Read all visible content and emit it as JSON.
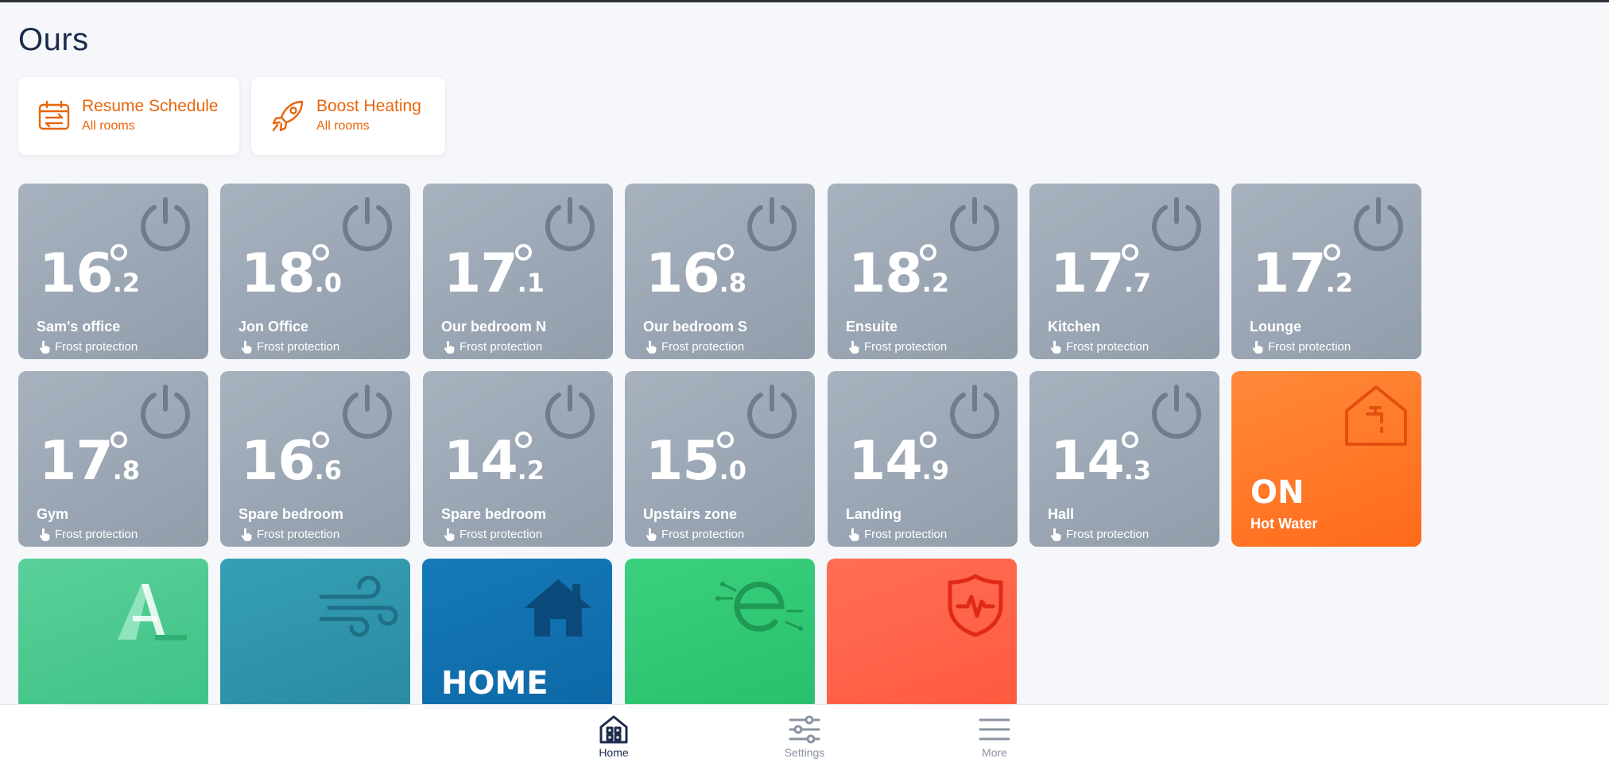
{
  "page": {
    "title": "Ours"
  },
  "actions": [
    {
      "title": "Resume Schedule",
      "subtitle": "All rooms",
      "icon": "calendar-arrows-icon"
    },
    {
      "title": "Boost Heating",
      "subtitle": "All rooms",
      "icon": "rocket-icon"
    }
  ],
  "rooms": [
    {
      "name": "Sam's office",
      "temp_int": "16",
      "temp_dec": ".2",
      "mode": "Frost protection"
    },
    {
      "name": "Jon Office",
      "temp_int": "18",
      "temp_dec": ".0",
      "mode": "Frost protection"
    },
    {
      "name": "Our bedroom N",
      "temp_int": "17",
      "temp_dec": ".1",
      "mode": "Frost protection"
    },
    {
      "name": "Our bedroom S",
      "temp_int": "16",
      "temp_dec": ".8",
      "mode": "Frost protection"
    },
    {
      "name": "Ensuite",
      "temp_int": "18",
      "temp_dec": ".2",
      "mode": "Frost protection"
    },
    {
      "name": "Kitchen",
      "temp_int": "17",
      "temp_dec": ".7",
      "mode": "Frost protection"
    },
    {
      "name": "Lounge",
      "temp_int": "17",
      "temp_dec": ".2",
      "mode": "Frost protection"
    },
    {
      "name": "Gym",
      "temp_int": "17",
      "temp_dec": ".8",
      "mode": "Frost protection"
    },
    {
      "name": "Spare bedroom",
      "temp_int": "16",
      "temp_dec": ".6",
      "mode": "Frost protection"
    },
    {
      "name": "Spare bedroom",
      "temp_int": "14",
      "temp_dec": ".2",
      "mode": "Frost protection"
    },
    {
      "name": "Upstairs zone",
      "temp_int": "15",
      "temp_dec": ".0",
      "mode": "Frost protection"
    },
    {
      "name": "Landing",
      "temp_int": "14",
      "temp_dec": ".9",
      "mode": "Frost protection"
    },
    {
      "name": "Hall",
      "temp_int": "14",
      "temp_dec": ".3",
      "mode": "Frost protection"
    }
  ],
  "hot_water": {
    "state": "ON",
    "name": "Hot Water",
    "icon": "house-tap-icon"
  },
  "home_tile": {
    "label": "HOME",
    "icon": "house-icon"
  },
  "tiles": [
    {
      "icon": "a-logo-icon"
    },
    {
      "icon": "wind-icon"
    },
    {
      "icon": "house-icon"
    },
    {
      "icon": "e-logo-icon"
    },
    {
      "icon": "shield-pulse-icon"
    }
  ],
  "nav": [
    {
      "label": "Home",
      "icon": "home-grid-icon",
      "active": true
    },
    {
      "label": "Settings",
      "icon": "sliders-icon",
      "active": false
    },
    {
      "label": "More",
      "icon": "menu-icon",
      "active": false
    }
  ],
  "colors": {
    "accent": "#e8650b",
    "room_tile": "#9aa5b3",
    "hot_water": "#ff6a1a",
    "nav_active": "#1b2b4b",
    "nav_inactive": "#8a93a2"
  }
}
